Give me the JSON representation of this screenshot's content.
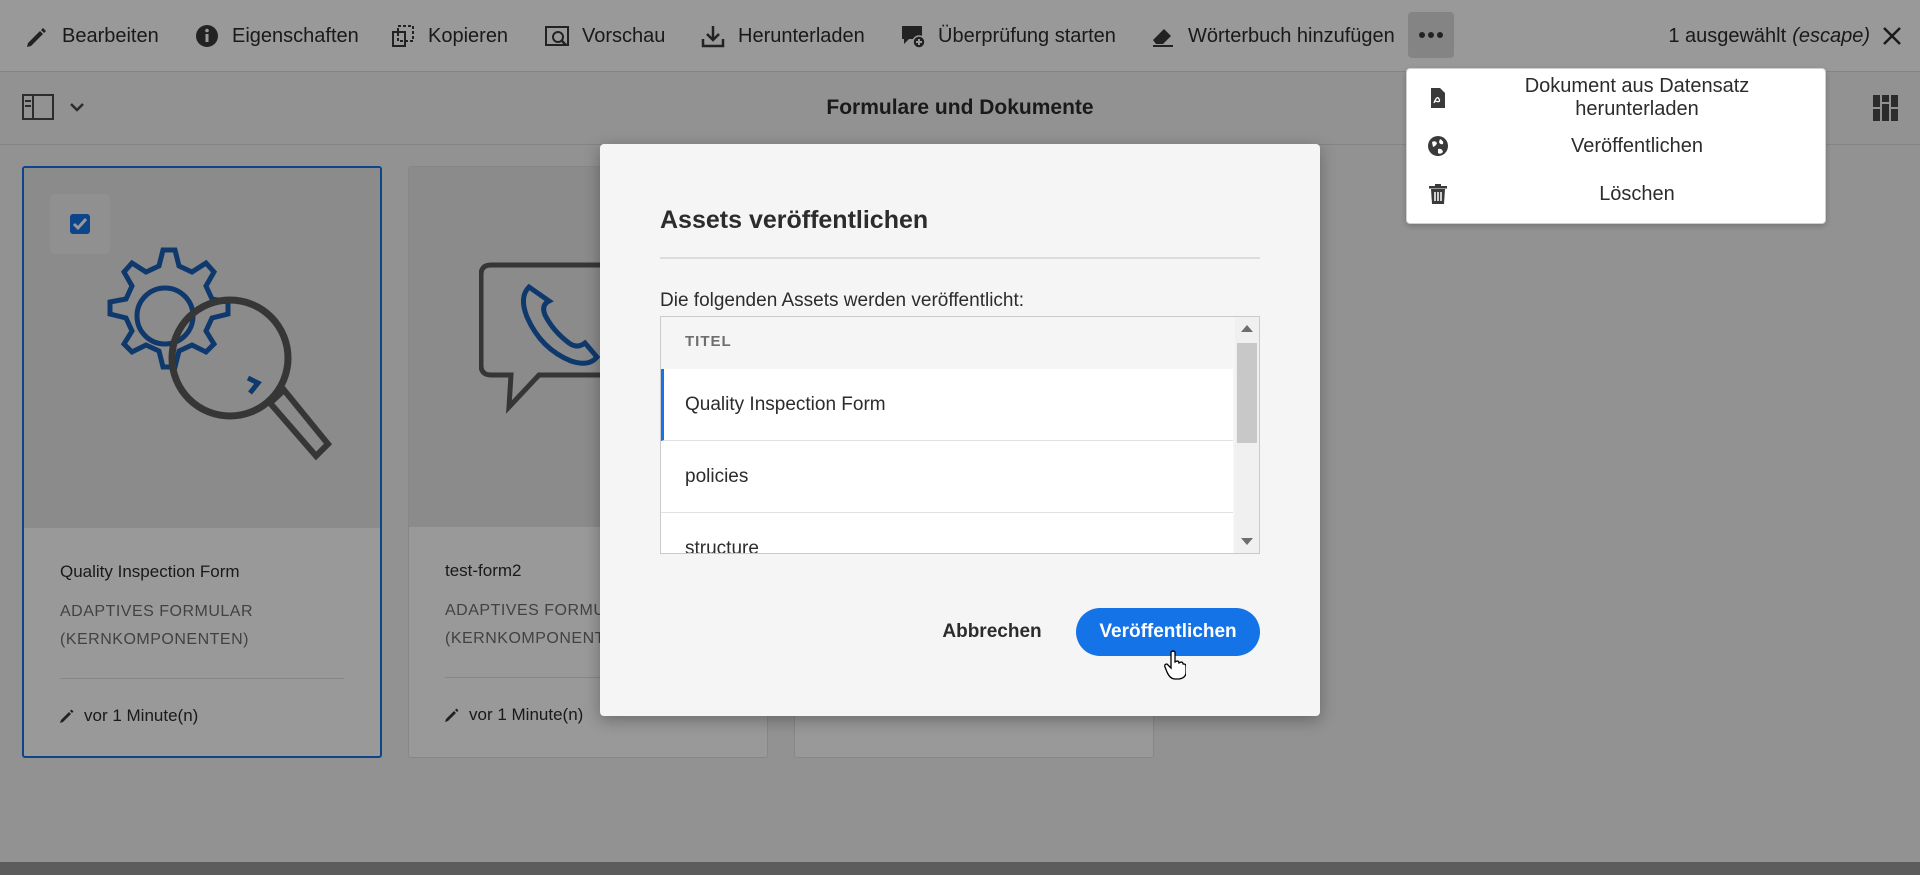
{
  "actionbar": {
    "actions": [
      {
        "label": "Bearbeiten",
        "icon": "pencil-icon"
      },
      {
        "label": "Eigenschaften",
        "icon": "info-icon"
      },
      {
        "label": "Kopieren",
        "icon": "copy-icon"
      },
      {
        "label": "Vorschau",
        "icon": "preview-icon"
      },
      {
        "label": "Herunterladen",
        "icon": "download-icon"
      },
      {
        "label": "Überprüfung starten",
        "icon": "review-icon"
      },
      {
        "label": "Wörterbuch hinzufügen",
        "icon": "eraser-icon"
      }
    ],
    "more_icon": "more-icon",
    "selection_text": "1 ausgewählt",
    "selection_hint": "(escape)",
    "close_icon": "close-icon"
  },
  "header": {
    "title": "Formulare und Dokumente",
    "rail_icon": "rail-toggle-icon",
    "view_icon": "view-switch-icon"
  },
  "more_menu": {
    "items": [
      {
        "label": "Dokument aus Datensatz herunterladen",
        "icon": "pdf-icon"
      },
      {
        "label": "Veröffentlichen",
        "icon": "globe-icon"
      },
      {
        "label": "Löschen",
        "icon": "trash-icon"
      }
    ]
  },
  "cards": [
    {
      "title": "Quality Inspection Form",
      "type_line1": "ADAPTIVES FORMULAR",
      "type_line2": "(KERNKOMPONENTEN)",
      "meta": "vor 1 Minute(n)",
      "selected": true,
      "thumb_icon": "gear-magnifier-icon"
    },
    {
      "title": "test-form2",
      "type_line1": "ADAPTIVES FORMUL",
      "type_line2": "(KERNKOMPONENTE",
      "meta": "vor 1 Minute(n)",
      "selected": false,
      "thumb_icon": "phone-chat-icon"
    }
  ],
  "dialog": {
    "title": "Assets veröffentlichen",
    "intro": "Die folgenden Assets werden veröffentlicht:",
    "column_header": "TITEL",
    "rows": [
      "Quality Inspection Form",
      "policies",
      "structure"
    ],
    "cancel_label": "Abbrechen",
    "confirm_label": "Veröffentlichen"
  },
  "colors": {
    "accent": "#1473e6",
    "overlay": "rgba(0,0,0,0.4)"
  }
}
